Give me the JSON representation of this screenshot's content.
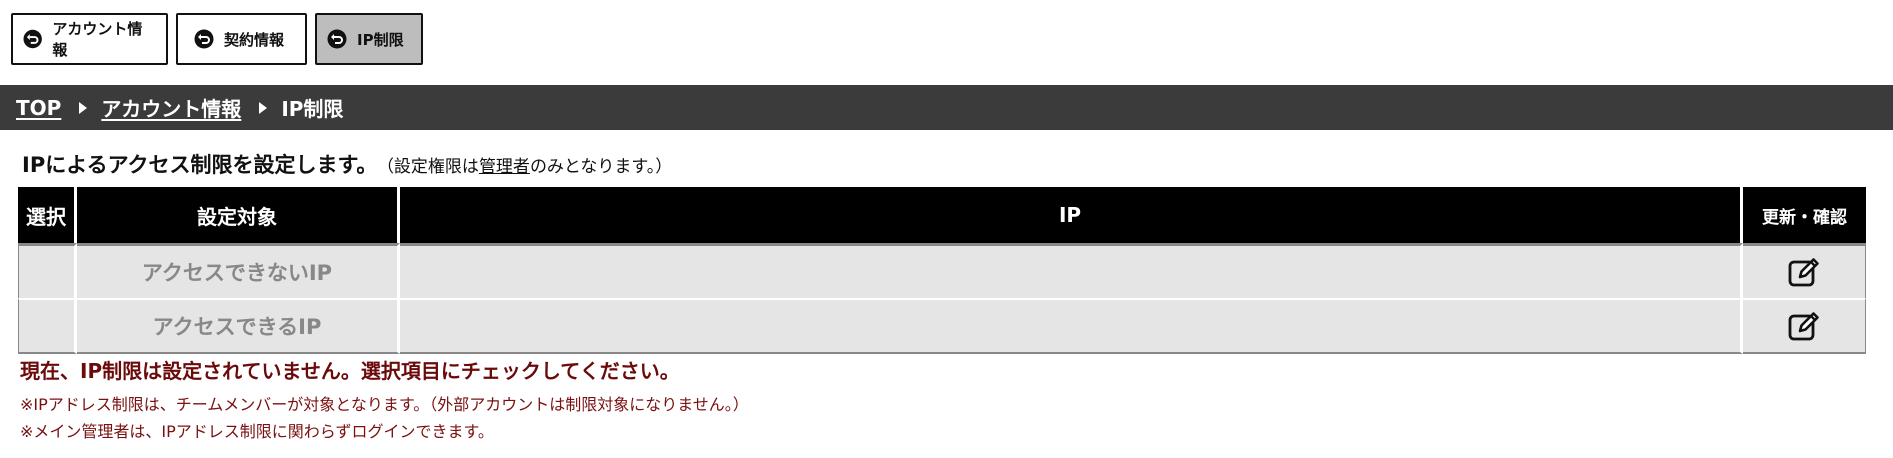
{
  "tabs": [
    {
      "label": "アカウント情報",
      "icon": "return-icon"
    },
    {
      "label": "契約情報",
      "icon": "return-icon"
    },
    {
      "label": "IP制限",
      "icon": "return-icon",
      "active": true
    }
  ],
  "breadcrumb": {
    "top": "TOP",
    "account": "アカウント情報",
    "current": "IP制限"
  },
  "intro": {
    "title": "IPによるアクセス制限を設定します。",
    "note_pre": "（設定権限は",
    "note_link": "管理者",
    "note_post": "のみとなります。）"
  },
  "table": {
    "headers": {
      "select": "選択",
      "target": "設定対象",
      "ip": "IP",
      "update": "更新・確認"
    },
    "rows": [
      {
        "target": "アクセスできないIP",
        "ip": "",
        "edit_icon": "edit-icon"
      },
      {
        "target": "アクセスできるIP",
        "ip": "",
        "edit_icon": "edit-icon"
      }
    ]
  },
  "messages": {
    "warning": "現在、IP制限は設定されていません。選択項目にチェックしてください。",
    "note1": "※IPアドレス制限は、チームメンバーが対象となります。（外部アカウントは制限対象になりません。）",
    "note2": "※メイン管理者は、IPアドレス制限に関わらずログインできます。"
  },
  "colors": {
    "breadcrumb_bg": "#3b3b3b",
    "header_bg": "#000000",
    "row_bg": "#e5e5e5",
    "active_tab": "#bdbdbd",
    "warning": "#6b0a0a"
  }
}
